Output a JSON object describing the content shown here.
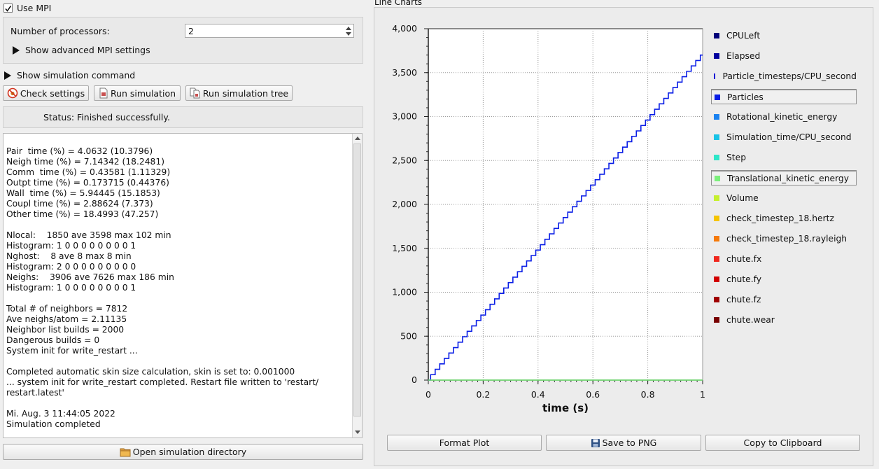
{
  "mpi": {
    "use_mpi_label": "Use MPI",
    "use_mpi_checked": true,
    "processors_label": "Number of processors:",
    "processors_value": "2",
    "advanced_label": "Show advanced MPI settings"
  },
  "sim": {
    "show_command_label": "Show simulation command",
    "check_settings": "Check settings",
    "run_simulation": "Run simulation",
    "run_tree": "Run simulation tree",
    "status": "Status: Finished successfully.",
    "open_dir": "Open simulation directory"
  },
  "log_text": "Pair  time (%) = 4.0632 (10.3796)\nNeigh time (%) = 7.14342 (18.2481)\nComm  time (%) = 0.43581 (1.11329)\nOutpt time (%) = 0.173715 (0.44376)\nWall  time (%) = 5.94445 (15.1853)\nCoupl time (%) = 2.88624 (7.373)\nOther time (%) = 18.4993 (47.257)\n\nNlocal:    1850 ave 3598 max 102 min\nHistogram: 1 0 0 0 0 0 0 0 0 1\nNghost:    8 ave 8 max 8 min\nHistogram: 2 0 0 0 0 0 0 0 0 0\nNeighs:    3906 ave 7626 max 186 min\nHistogram: 1 0 0 0 0 0 0 0 0 1\n\nTotal # of neighbors = 7812\nAve neighs/atom = 2.11135\nNeighbor list builds = 2000\nDangerous builds = 0\nSystem init for write_restart ...\n\nCompleted automatic skin size calculation, skin is set to: 0.001000\n... system init for write_restart completed. Restart file written to 'restart/\nrestart.latest'\n\nMi. Aug. 3 11:44:05 2022\nSimulation completed",
  "chart_panel": {
    "title": "Line Charts",
    "format_plot": "Format Plot",
    "save_png": "Save to PNG",
    "copy_clipboard": "Copy to Clipboard"
  },
  "chart_data": {
    "type": "line",
    "xlabel": "time (s)",
    "ylabel": "",
    "xlim": [
      0,
      1
    ],
    "ylim": [
      0,
      4000
    ],
    "x_ticks": [
      "0",
      "0.2",
      "0.4",
      "0.6",
      "0.8",
      "1"
    ],
    "y_ticks": [
      "0",
      "500",
      "1,000",
      "1,500",
      "2,000",
      "2,500",
      "3,000",
      "3,500",
      "4,000"
    ],
    "grid": true,
    "legend_placement": "right",
    "series": [
      {
        "name": "CPULeft",
        "color": "#00007a",
        "selected": false
      },
      {
        "name": "Elapsed",
        "color": "#00009e",
        "selected": false
      },
      {
        "name": "Particle_timesteps/CPU_second",
        "color": "#0000d6",
        "selected": false
      },
      {
        "name": "Particles",
        "color": "#0a1ee6",
        "selected": true,
        "x": [
          0,
          1
        ],
        "y": [
          0,
          3700
        ]
      },
      {
        "name": "Rotational_kinetic_energy",
        "color": "#1a82f0",
        "selected": false
      },
      {
        "name": "Simulation_time/CPU_second",
        "color": "#19c3e6",
        "selected": false
      },
      {
        "name": "Step",
        "color": "#2ee6c8",
        "selected": false
      },
      {
        "name": "Translational_kinetic_energy",
        "color": "#7cf07c",
        "selected": true,
        "x": [
          0,
          1
        ],
        "y": [
          0,
          0
        ]
      },
      {
        "name": "Volume",
        "color": "#c6f02e",
        "selected": false
      },
      {
        "name": "check_timestep_18.hertz",
        "color": "#f5c400",
        "selected": false
      },
      {
        "name": "check_timestep_18.rayleigh",
        "color": "#f57a0a",
        "selected": false
      },
      {
        "name": "chute.fx",
        "color": "#f0281e",
        "selected": false
      },
      {
        "name": "chute.fy",
        "color": "#d20000",
        "selected": false
      },
      {
        "name": "chute.fz",
        "color": "#a00000",
        "selected": false
      },
      {
        "name": "chute.wear",
        "color": "#780000",
        "selected": false
      }
    ]
  }
}
